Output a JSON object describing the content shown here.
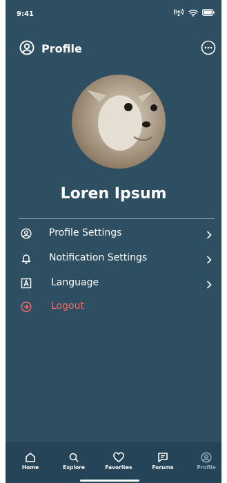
{
  "status_bar": {
    "time": "9:41"
  },
  "header": {
    "title": "Profile"
  },
  "profile": {
    "name": "Loren Ipsum"
  },
  "menu": [
    {
      "label": "Profile Settings",
      "icon": "user-circle-icon"
    },
    {
      "label": "Notification Settings",
      "icon": "bell-icon"
    },
    {
      "label": "Language",
      "icon": "language-icon"
    },
    {
      "label": "Logout",
      "icon": "logout-icon",
      "color": "#f06a6a"
    }
  ],
  "bottom_nav": [
    {
      "label": "Home",
      "icon": "home-icon"
    },
    {
      "label": "Explore",
      "icon": "search-icon"
    },
    {
      "label": "Favorites",
      "icon": "heart-icon"
    },
    {
      "label": "Forums",
      "icon": "chat-icon"
    },
    {
      "label": "Profile",
      "icon": "user-circle-icon",
      "active": true
    }
  ],
  "colors": {
    "background": "#2e4f62",
    "nav_background": "#254457",
    "logout": "#f06a6a",
    "active_tab": "#8fb2c5"
  }
}
